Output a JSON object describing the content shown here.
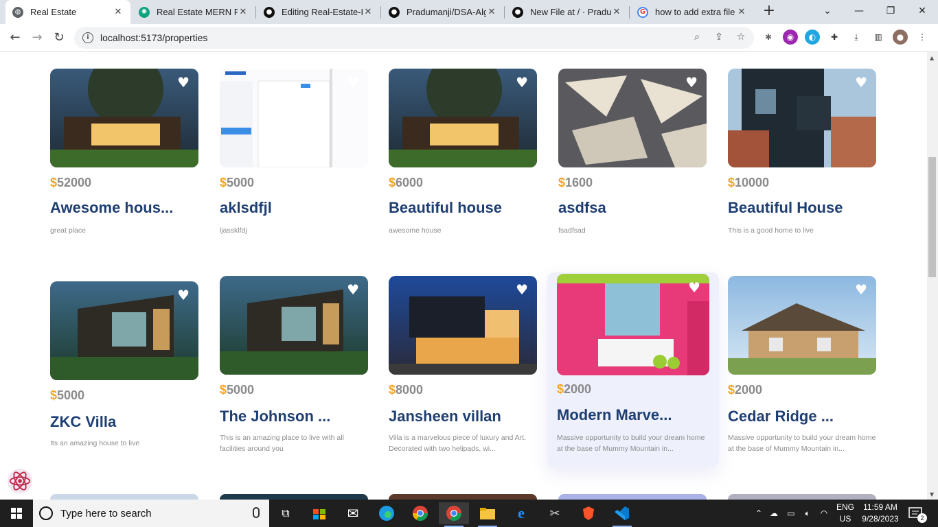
{
  "browser": {
    "tabs": [
      {
        "title": "Real Estate",
        "active": true
      },
      {
        "title": "Real Estate MERN Pro",
        "active": false
      },
      {
        "title": "Editing Real-Estate-Fu",
        "active": false
      },
      {
        "title": "Pradumanji/DSA-Algo",
        "active": false
      },
      {
        "title": "New File at / · Pradum",
        "active": false
      },
      {
        "title": "how to add extra file",
        "active": false
      }
    ],
    "new_tab": "+",
    "url": "localhost:5173/properties"
  },
  "properties": [
    {
      "price": "52000",
      "name": "Awesome hous...",
      "desc": "great place"
    },
    {
      "price": "5000",
      "name": "aklsdfjl",
      "desc": "ljassklfdj"
    },
    {
      "price": "6000",
      "name": "Beautiful house",
      "desc": "awesome house"
    },
    {
      "price": "1600",
      "name": "asdfsa",
      "desc": "fsadfsad"
    },
    {
      "price": "10000",
      "name": "Beautiful House",
      "desc": "This is a good home to live"
    },
    {
      "price": "5000",
      "name": "ZKC Villa",
      "desc": "Its an amazing house to live"
    },
    {
      "price": "5000",
      "name": "The Johnson ...",
      "desc": "This is an amazing place to live with all facilities around you"
    },
    {
      "price": "8000",
      "name": "Jansheen villan",
      "desc": "Villa is a marvelous piece of luxury and Art. Decorated with two helipads, wi..."
    },
    {
      "price": "2000",
      "name": "Modern Marve...",
      "desc": "Massive opportunity to build your dream home at the base of Mummy Mountain in..."
    },
    {
      "price": "2000",
      "name": "Cedar Ridge ...",
      "desc": "Massive opportunity to build your dream home at the base of Mummy Mountain in..."
    }
  ],
  "currency_symbol": "$",
  "taskbar": {
    "search_placeholder": "Type here to search",
    "lang_line1": "ENG",
    "lang_line2": "US",
    "time": "11:59 AM",
    "date": "9/28/2023",
    "notification_count": "2"
  }
}
